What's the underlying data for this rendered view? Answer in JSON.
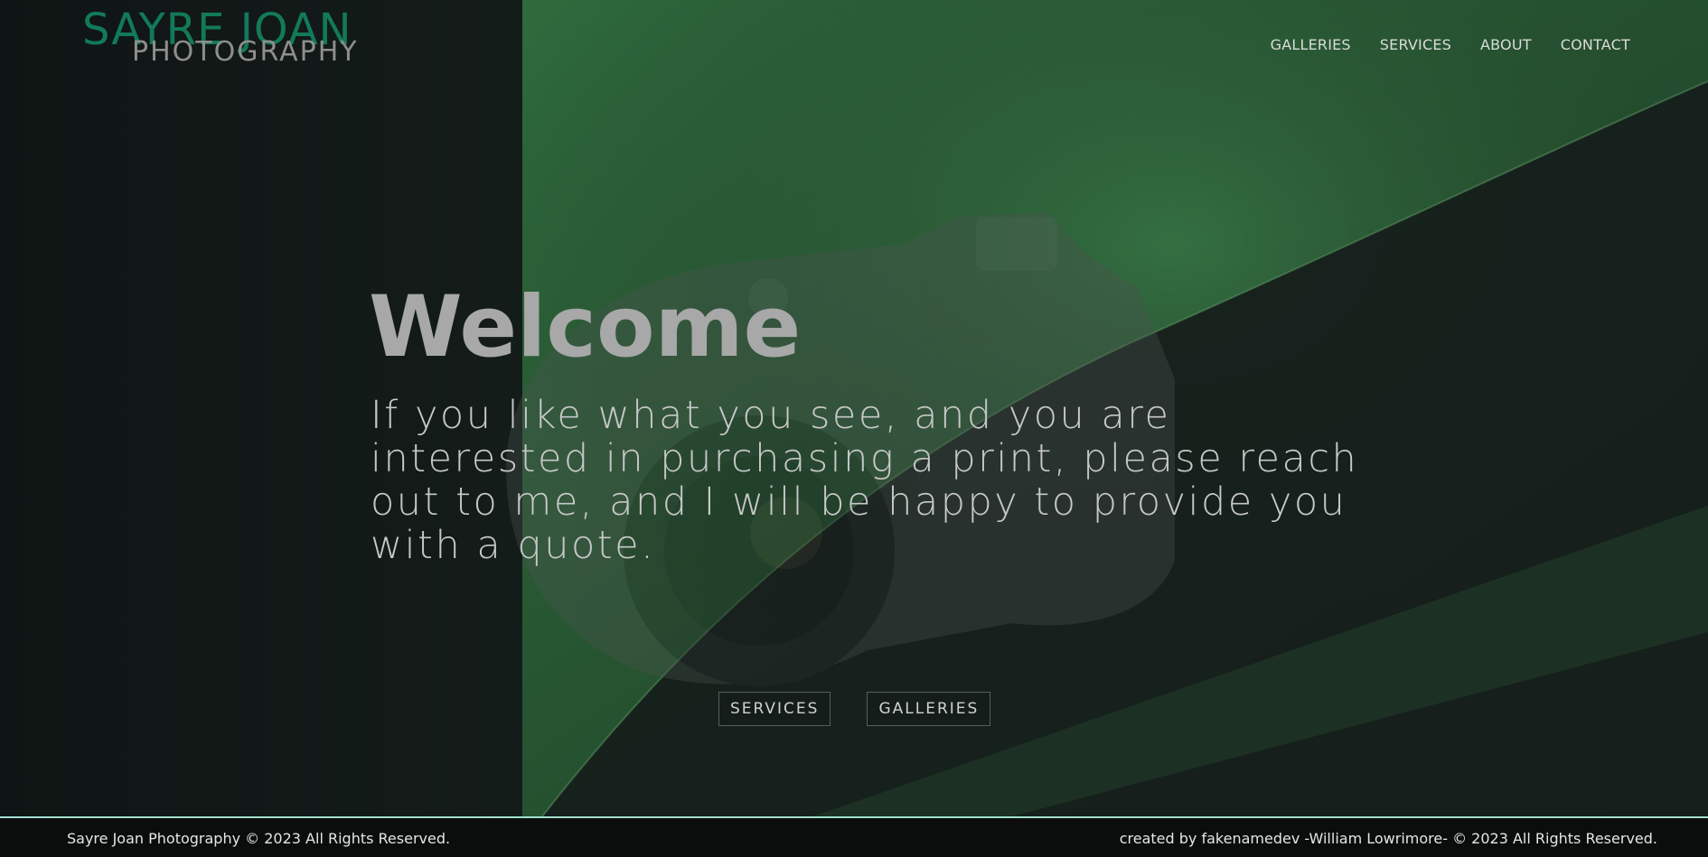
{
  "brand": {
    "name": "SAYRE JOAN",
    "tagline": "PHOTOGRAPHY"
  },
  "nav": {
    "items": [
      {
        "label": "GALLERIES"
      },
      {
        "label": "SERVICES"
      },
      {
        "label": "ABOUT"
      },
      {
        "label": "CONTACT"
      }
    ]
  },
  "hero": {
    "title": "Welcome",
    "message": "If you like what you see, and you are interested in purchasing a print, please reach out to me, and I will be happy to provide you with a quote.",
    "buttons": [
      {
        "label": "SERVICES"
      },
      {
        "label": "GALLERIES"
      }
    ]
  },
  "footer": {
    "left": "Sayre Joan Photography © 2023 All Rights Reserved.",
    "right": "created by fakenamedev -William Lowrimore- © 2023 All Rights Reserved."
  },
  "colors": {
    "brand_green": "#127a58",
    "footer_accent": "#9fe0cf",
    "background": "#121918"
  }
}
